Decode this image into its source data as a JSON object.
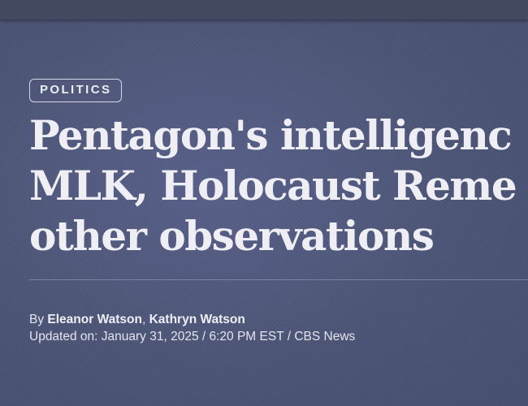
{
  "article": {
    "category": "POLITICS",
    "headline_lines": [
      "Pentagon's intelligenc",
      "MLK, Holocaust Reme",
      "other observations"
    ],
    "byline_prefix": "By",
    "authors": [
      "Eleanor Watson",
      "Kathryn Watson"
    ],
    "author_separator": ", ",
    "updated_label": "Updated on:",
    "date": "January 31, 2025",
    "separator": " / ",
    "time": "6:20 PM EST",
    "source": "CBS News"
  }
}
